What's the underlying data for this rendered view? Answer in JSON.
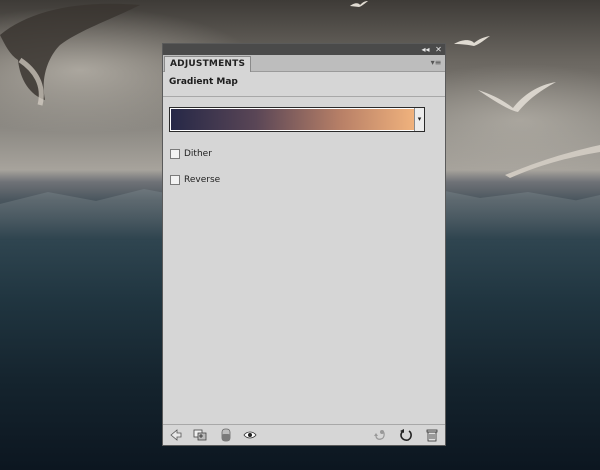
{
  "panel": {
    "tab_label": "ADJUSTMENTS",
    "title": "Gradient Map",
    "gradient": {
      "start_color": "#262847",
      "end_color": "#f0b27d"
    },
    "options": [
      {
        "label": "Dither",
        "checked": false
      },
      {
        "label": "Reverse",
        "checked": false
      }
    ],
    "titlebar_icons": [
      "collapse-icon",
      "close-icon"
    ],
    "menu_icon": "panel-menu-icon",
    "footer_icons": [
      "back-arrow-icon",
      "clip-to-layer-icon",
      "layer-mask-icon",
      "visibility-eye-icon",
      "previous-state-icon",
      "reset-icon",
      "trash-icon"
    ]
  }
}
